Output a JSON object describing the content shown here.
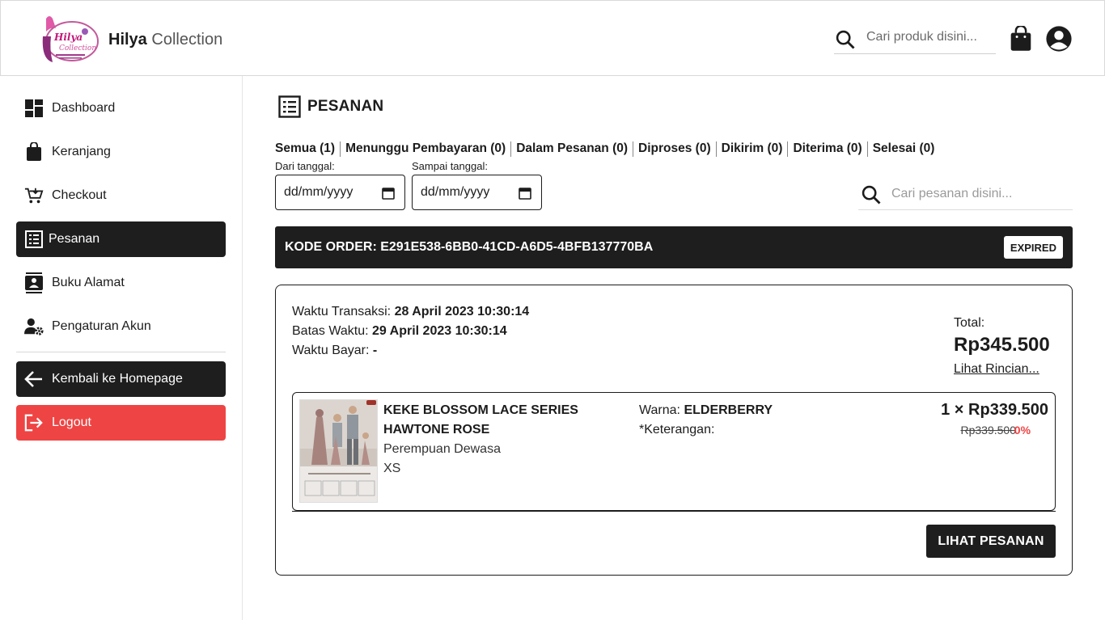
{
  "header": {
    "brand_bold": "Hilya",
    "brand_light": "Collection",
    "search_placeholder": "Cari produk disini..."
  },
  "sidebar": {
    "items": [
      {
        "label": "Dashboard",
        "icon": "dashboard-icon"
      },
      {
        "label": "Keranjang",
        "icon": "bag-icon"
      },
      {
        "label": "Checkout",
        "icon": "cart-icon"
      },
      {
        "label": "Pesanan",
        "icon": "list-icon",
        "active": true
      },
      {
        "label": "Buku Alamat",
        "icon": "contacts-icon"
      },
      {
        "label": "Pengaturan Akun",
        "icon": "user-gear-icon"
      }
    ],
    "home_label": "Kembali ke Homepage",
    "logout_label": "Logout"
  },
  "main": {
    "title": "PESANAN",
    "tabs": [
      {
        "label": "Semua (1)"
      },
      {
        "label": "Menunggu Pembayaran (0)"
      },
      {
        "label": "Dalam Pesanan (0)"
      },
      {
        "label": "Diproses (0)"
      },
      {
        "label": "Dikirim (0)"
      },
      {
        "label": "Diterima (0)"
      },
      {
        "label": "Selesai (0)"
      }
    ],
    "date_from_label": "Dari tanggal:",
    "date_to_label": "Sampai tanggal:",
    "date_placeholder": "dd/mm/yyyy",
    "order_search_placeholder": "Cari pesanan disini..."
  },
  "order": {
    "code": "KODE ORDER: E291E538-6BB0-41CD-A6D5-4BFB137770BA",
    "status": "EXPIRED",
    "transaction_label": "Waktu Transaksi:",
    "transaction_value": "28 April 2023 10:30:14",
    "deadline_label": "Batas Waktu:",
    "deadline_value": "29 April 2023 10:30:14",
    "paid_label": "Waktu Bayar:",
    "paid_value": "-",
    "total_label": "Total:",
    "total_value": "Rp345.500",
    "detail_link": "Lihat Rincian...",
    "view_button": "LIHAT PESANAN",
    "item": {
      "name_line1": "KEKE BLOSSOM LACE SERIES",
      "name_line2": "HAWTONE ROSE",
      "category": "Perempuan Dewasa",
      "size": "XS",
      "color_label": "Warna:",
      "color_value": "ELDERBERRY",
      "note_label": "*Keterangan:",
      "qty_price": "1 × Rp339.500",
      "old_price": "Rp339.500",
      "discount": "0%"
    }
  }
}
